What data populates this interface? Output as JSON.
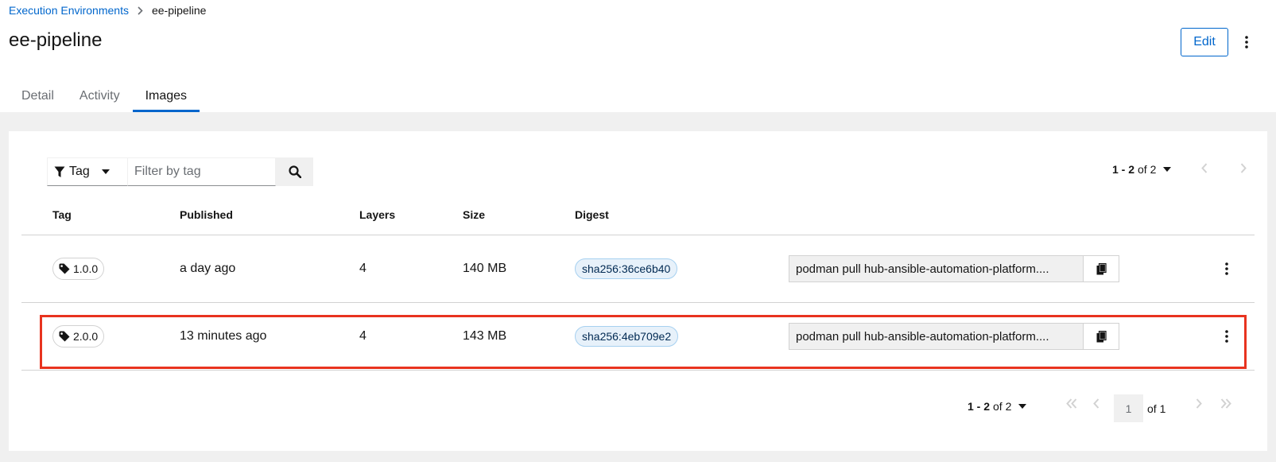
{
  "breadcrumb": {
    "parent": "Execution Environments",
    "current": "ee-pipeline"
  },
  "page_title": "ee-pipeline",
  "edit_label": "Edit",
  "tabs": [
    {
      "label": "Detail",
      "active": false
    },
    {
      "label": "Activity",
      "active": false
    },
    {
      "label": "Images",
      "active": true
    }
  ],
  "toolbar": {
    "filter_attribute": "Tag",
    "filter_placeholder": "Filter by tag",
    "pagination": {
      "range": "1 - 2",
      "of_text": "of 2"
    }
  },
  "table": {
    "columns": [
      "Tag",
      "Published",
      "Layers",
      "Size",
      "Digest"
    ],
    "rows": [
      {
        "tag": "1.0.0",
        "published": "a day ago",
        "layers": "4",
        "size": "140 MB",
        "digest": "sha256:36ce6b40",
        "pull_command": "podman pull hub-ansible-automation-platform...."
      },
      {
        "tag": "2.0.0",
        "published": "13 minutes ago",
        "layers": "4",
        "size": "143 MB",
        "digest": "sha256:4eb709e2",
        "pull_command": "podman pull hub-ansible-automation-platform...."
      }
    ]
  },
  "bottom_pagination": {
    "range": "1 - 2",
    "of_text": "of 2",
    "page_value": "1",
    "page_of": "of 1"
  },
  "colors": {
    "accent": "#0066cc",
    "highlight": "#e8331f",
    "background": "#f0f0f0",
    "digest_bg": "#e7f1fa"
  }
}
